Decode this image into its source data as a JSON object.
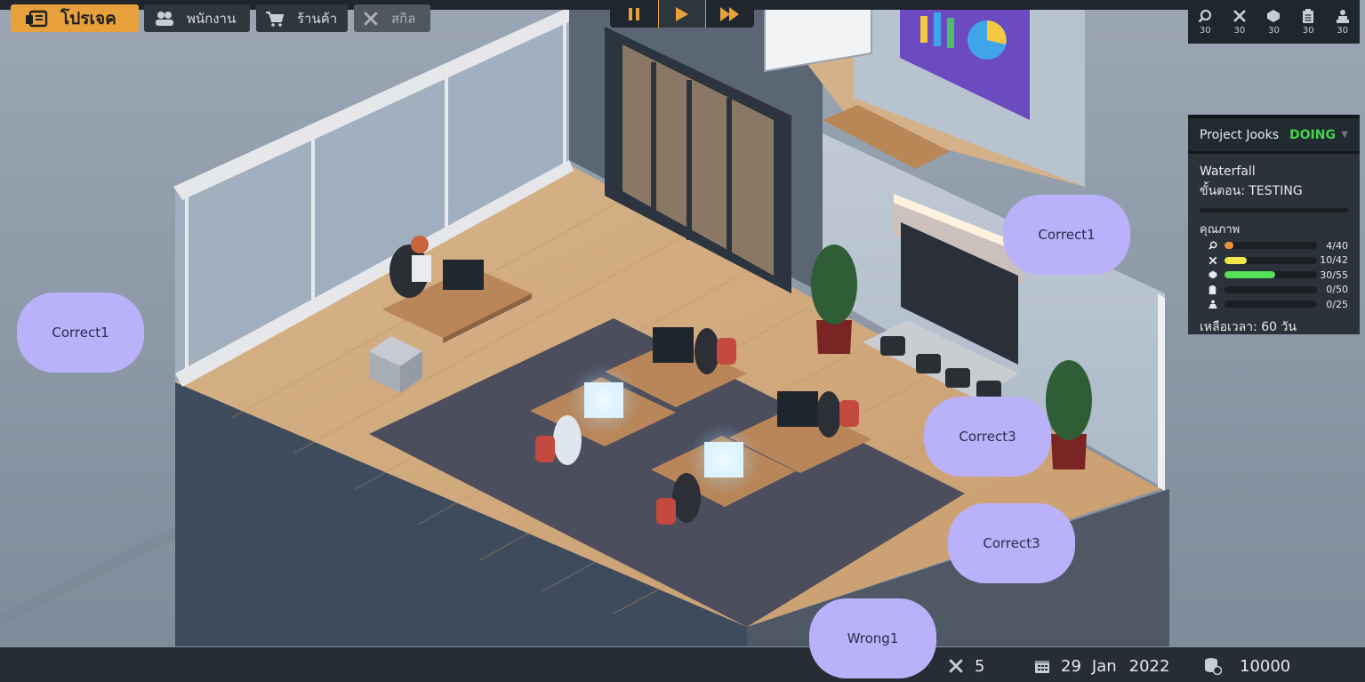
{
  "window": {
    "title": "Project Jooks"
  },
  "speed_controls": {
    "buttons": [
      {
        "icon": "pause-icon",
        "active": false
      },
      {
        "icon": "play-icon",
        "active": true
      },
      {
        "icon": "fast-forward-icon",
        "active": false
      }
    ]
  },
  "resources": [
    {
      "icon": "magnifier-icon",
      "value": "30"
    },
    {
      "icon": "wrench-screwdriver-icon",
      "value": "30"
    },
    {
      "icon": "cube-icon",
      "value": "30"
    },
    {
      "icon": "clipboard-icon",
      "value": "30"
    },
    {
      "icon": "people-icon",
      "value": "30"
    }
  ],
  "project": {
    "name": "Project Jooks",
    "status": "DOING",
    "method": "Waterfall",
    "phase": "ขั้นตอน: TESTING",
    "quality_label": "คุณภาพ",
    "quality": [
      {
        "icon": "magnifier-icon",
        "value": "4/40",
        "fraction": 0.1,
        "color": "#f0913a"
      },
      {
        "icon": "wrench-screwdriver-icon",
        "value": "10/42",
        "fraction": 0.238,
        "color": "#f0e64a"
      },
      {
        "icon": "cube-icon",
        "value": "30/55",
        "fraction": 0.545,
        "color": "#55e05a"
      },
      {
        "icon": "clipboard-icon",
        "value": "0/50",
        "fraction": 0,
        "color": "#55e05a"
      },
      {
        "icon": "people-icon",
        "value": "0/25",
        "fraction": 0,
        "color": "#55e05a"
      }
    ],
    "time_left": "เหลือเวลา: 60 วัน"
  },
  "bubbles": {
    "b1": "Correct1",
    "b2": "Correct1",
    "b3": "Correct3",
    "b4": "Correct3",
    "b5": "Wrong1"
  },
  "tabs": {
    "project": "โปรเจค",
    "employees": "พนักงาน",
    "shop": "ร้านค้า",
    "skills": "สกิล"
  },
  "status": {
    "tools": "5",
    "day": "29",
    "month": "Jan",
    "year": "2022",
    "money": "10000"
  },
  "colors": {
    "accent": "#e8a13a",
    "bubble": "#b9b2fb",
    "doing": "#46d24a"
  }
}
